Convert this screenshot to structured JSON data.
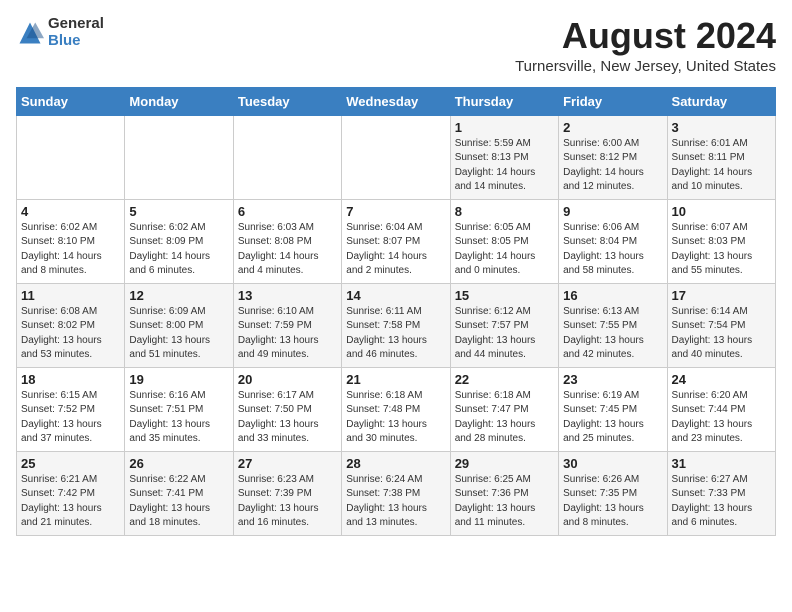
{
  "header": {
    "logo_general": "General",
    "logo_blue": "Blue",
    "title": "August 2024",
    "subtitle": "Turnersville, New Jersey, United States"
  },
  "weekdays": [
    "Sunday",
    "Monday",
    "Tuesday",
    "Wednesday",
    "Thursday",
    "Friday",
    "Saturday"
  ],
  "weeks": [
    [
      {
        "day": "",
        "info": ""
      },
      {
        "day": "",
        "info": ""
      },
      {
        "day": "",
        "info": ""
      },
      {
        "day": "",
        "info": ""
      },
      {
        "day": "1",
        "info": "Sunrise: 5:59 AM\nSunset: 8:13 PM\nDaylight: 14 hours\nand 14 minutes."
      },
      {
        "day": "2",
        "info": "Sunrise: 6:00 AM\nSunset: 8:12 PM\nDaylight: 14 hours\nand 12 minutes."
      },
      {
        "day": "3",
        "info": "Sunrise: 6:01 AM\nSunset: 8:11 PM\nDaylight: 14 hours\nand 10 minutes."
      }
    ],
    [
      {
        "day": "4",
        "info": "Sunrise: 6:02 AM\nSunset: 8:10 PM\nDaylight: 14 hours\nand 8 minutes."
      },
      {
        "day": "5",
        "info": "Sunrise: 6:02 AM\nSunset: 8:09 PM\nDaylight: 14 hours\nand 6 minutes."
      },
      {
        "day": "6",
        "info": "Sunrise: 6:03 AM\nSunset: 8:08 PM\nDaylight: 14 hours\nand 4 minutes."
      },
      {
        "day": "7",
        "info": "Sunrise: 6:04 AM\nSunset: 8:07 PM\nDaylight: 14 hours\nand 2 minutes."
      },
      {
        "day": "8",
        "info": "Sunrise: 6:05 AM\nSunset: 8:05 PM\nDaylight: 14 hours\nand 0 minutes."
      },
      {
        "day": "9",
        "info": "Sunrise: 6:06 AM\nSunset: 8:04 PM\nDaylight: 13 hours\nand 58 minutes."
      },
      {
        "day": "10",
        "info": "Sunrise: 6:07 AM\nSunset: 8:03 PM\nDaylight: 13 hours\nand 55 minutes."
      }
    ],
    [
      {
        "day": "11",
        "info": "Sunrise: 6:08 AM\nSunset: 8:02 PM\nDaylight: 13 hours\nand 53 minutes."
      },
      {
        "day": "12",
        "info": "Sunrise: 6:09 AM\nSunset: 8:00 PM\nDaylight: 13 hours\nand 51 minutes."
      },
      {
        "day": "13",
        "info": "Sunrise: 6:10 AM\nSunset: 7:59 PM\nDaylight: 13 hours\nand 49 minutes."
      },
      {
        "day": "14",
        "info": "Sunrise: 6:11 AM\nSunset: 7:58 PM\nDaylight: 13 hours\nand 46 minutes."
      },
      {
        "day": "15",
        "info": "Sunrise: 6:12 AM\nSunset: 7:57 PM\nDaylight: 13 hours\nand 44 minutes."
      },
      {
        "day": "16",
        "info": "Sunrise: 6:13 AM\nSunset: 7:55 PM\nDaylight: 13 hours\nand 42 minutes."
      },
      {
        "day": "17",
        "info": "Sunrise: 6:14 AM\nSunset: 7:54 PM\nDaylight: 13 hours\nand 40 minutes."
      }
    ],
    [
      {
        "day": "18",
        "info": "Sunrise: 6:15 AM\nSunset: 7:52 PM\nDaylight: 13 hours\nand 37 minutes."
      },
      {
        "day": "19",
        "info": "Sunrise: 6:16 AM\nSunset: 7:51 PM\nDaylight: 13 hours\nand 35 minutes."
      },
      {
        "day": "20",
        "info": "Sunrise: 6:17 AM\nSunset: 7:50 PM\nDaylight: 13 hours\nand 33 minutes."
      },
      {
        "day": "21",
        "info": "Sunrise: 6:18 AM\nSunset: 7:48 PM\nDaylight: 13 hours\nand 30 minutes."
      },
      {
        "day": "22",
        "info": "Sunrise: 6:18 AM\nSunset: 7:47 PM\nDaylight: 13 hours\nand 28 minutes."
      },
      {
        "day": "23",
        "info": "Sunrise: 6:19 AM\nSunset: 7:45 PM\nDaylight: 13 hours\nand 25 minutes."
      },
      {
        "day": "24",
        "info": "Sunrise: 6:20 AM\nSunset: 7:44 PM\nDaylight: 13 hours\nand 23 minutes."
      }
    ],
    [
      {
        "day": "25",
        "info": "Sunrise: 6:21 AM\nSunset: 7:42 PM\nDaylight: 13 hours\nand 21 minutes."
      },
      {
        "day": "26",
        "info": "Sunrise: 6:22 AM\nSunset: 7:41 PM\nDaylight: 13 hours\nand 18 minutes."
      },
      {
        "day": "27",
        "info": "Sunrise: 6:23 AM\nSunset: 7:39 PM\nDaylight: 13 hours\nand 16 minutes."
      },
      {
        "day": "28",
        "info": "Sunrise: 6:24 AM\nSunset: 7:38 PM\nDaylight: 13 hours\nand 13 minutes."
      },
      {
        "day": "29",
        "info": "Sunrise: 6:25 AM\nSunset: 7:36 PM\nDaylight: 13 hours\nand 11 minutes."
      },
      {
        "day": "30",
        "info": "Sunrise: 6:26 AM\nSunset: 7:35 PM\nDaylight: 13 hours\nand 8 minutes."
      },
      {
        "day": "31",
        "info": "Sunrise: 6:27 AM\nSunset: 7:33 PM\nDaylight: 13 hours\nand 6 minutes."
      }
    ]
  ]
}
